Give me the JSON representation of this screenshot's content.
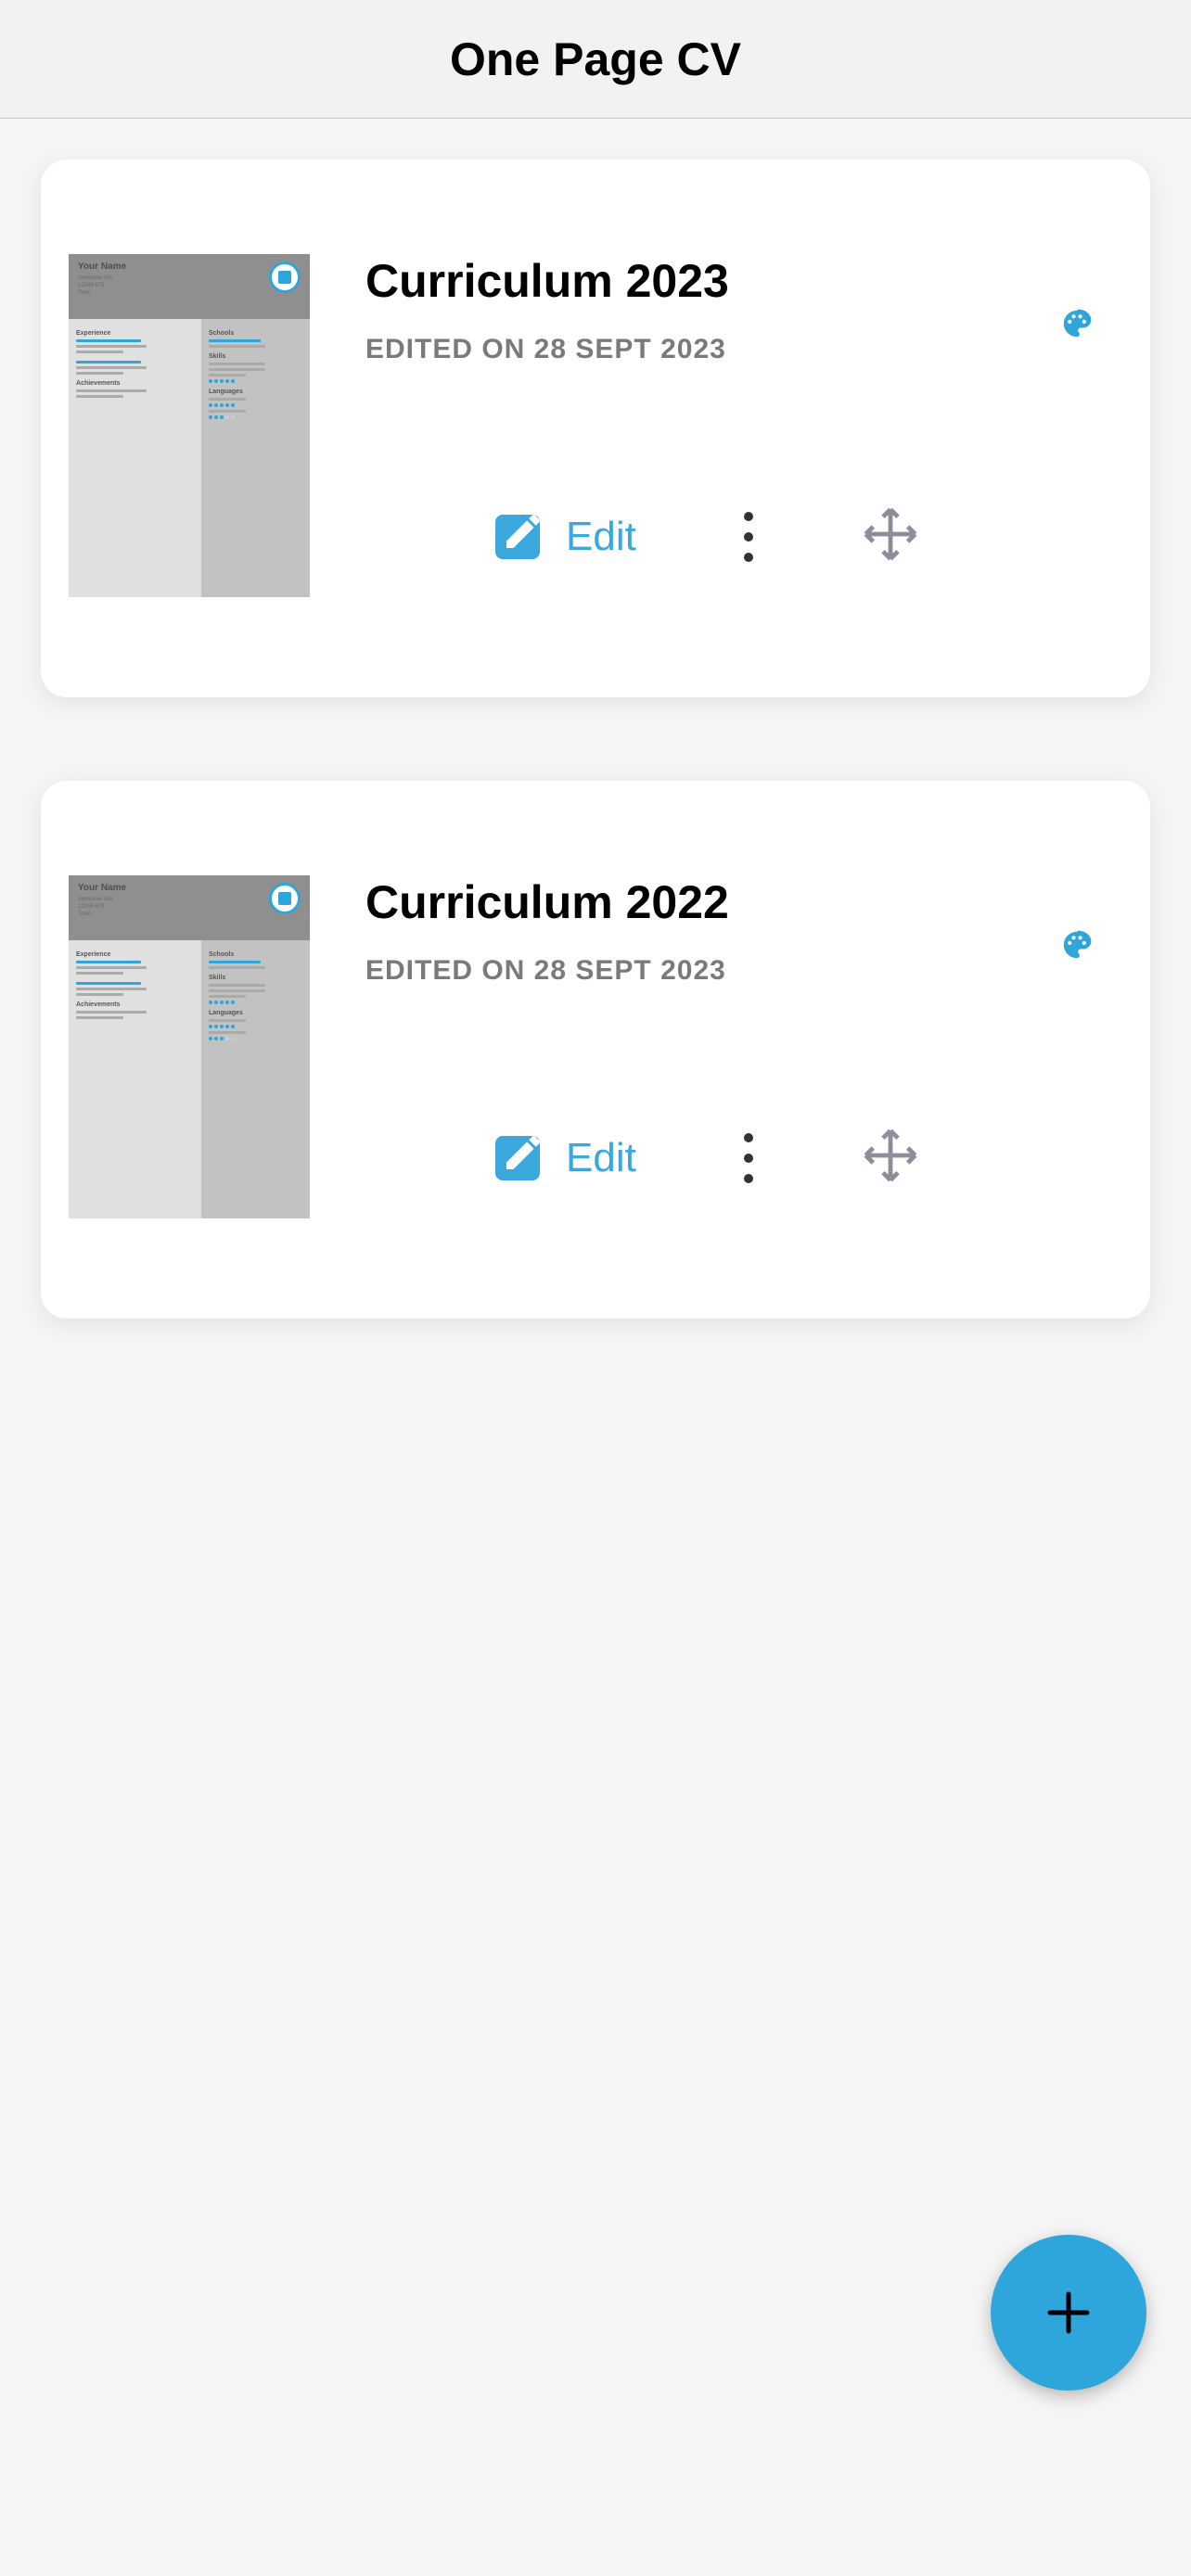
{
  "header": {
    "title": "One Page CV"
  },
  "edit_label": "Edit",
  "thumb": {
    "name": "Your Name",
    "left": [
      "Experience",
      "Achievements"
    ],
    "right": [
      "Schools",
      "Skills",
      "Languages"
    ]
  },
  "cvs": [
    {
      "title": "Curriculum 2023",
      "edited": "EDITED ON 28 SEPT 2023"
    },
    {
      "title": "Curriculum 2022",
      "edited": "EDITED ON 28 SEPT 2023"
    }
  ]
}
